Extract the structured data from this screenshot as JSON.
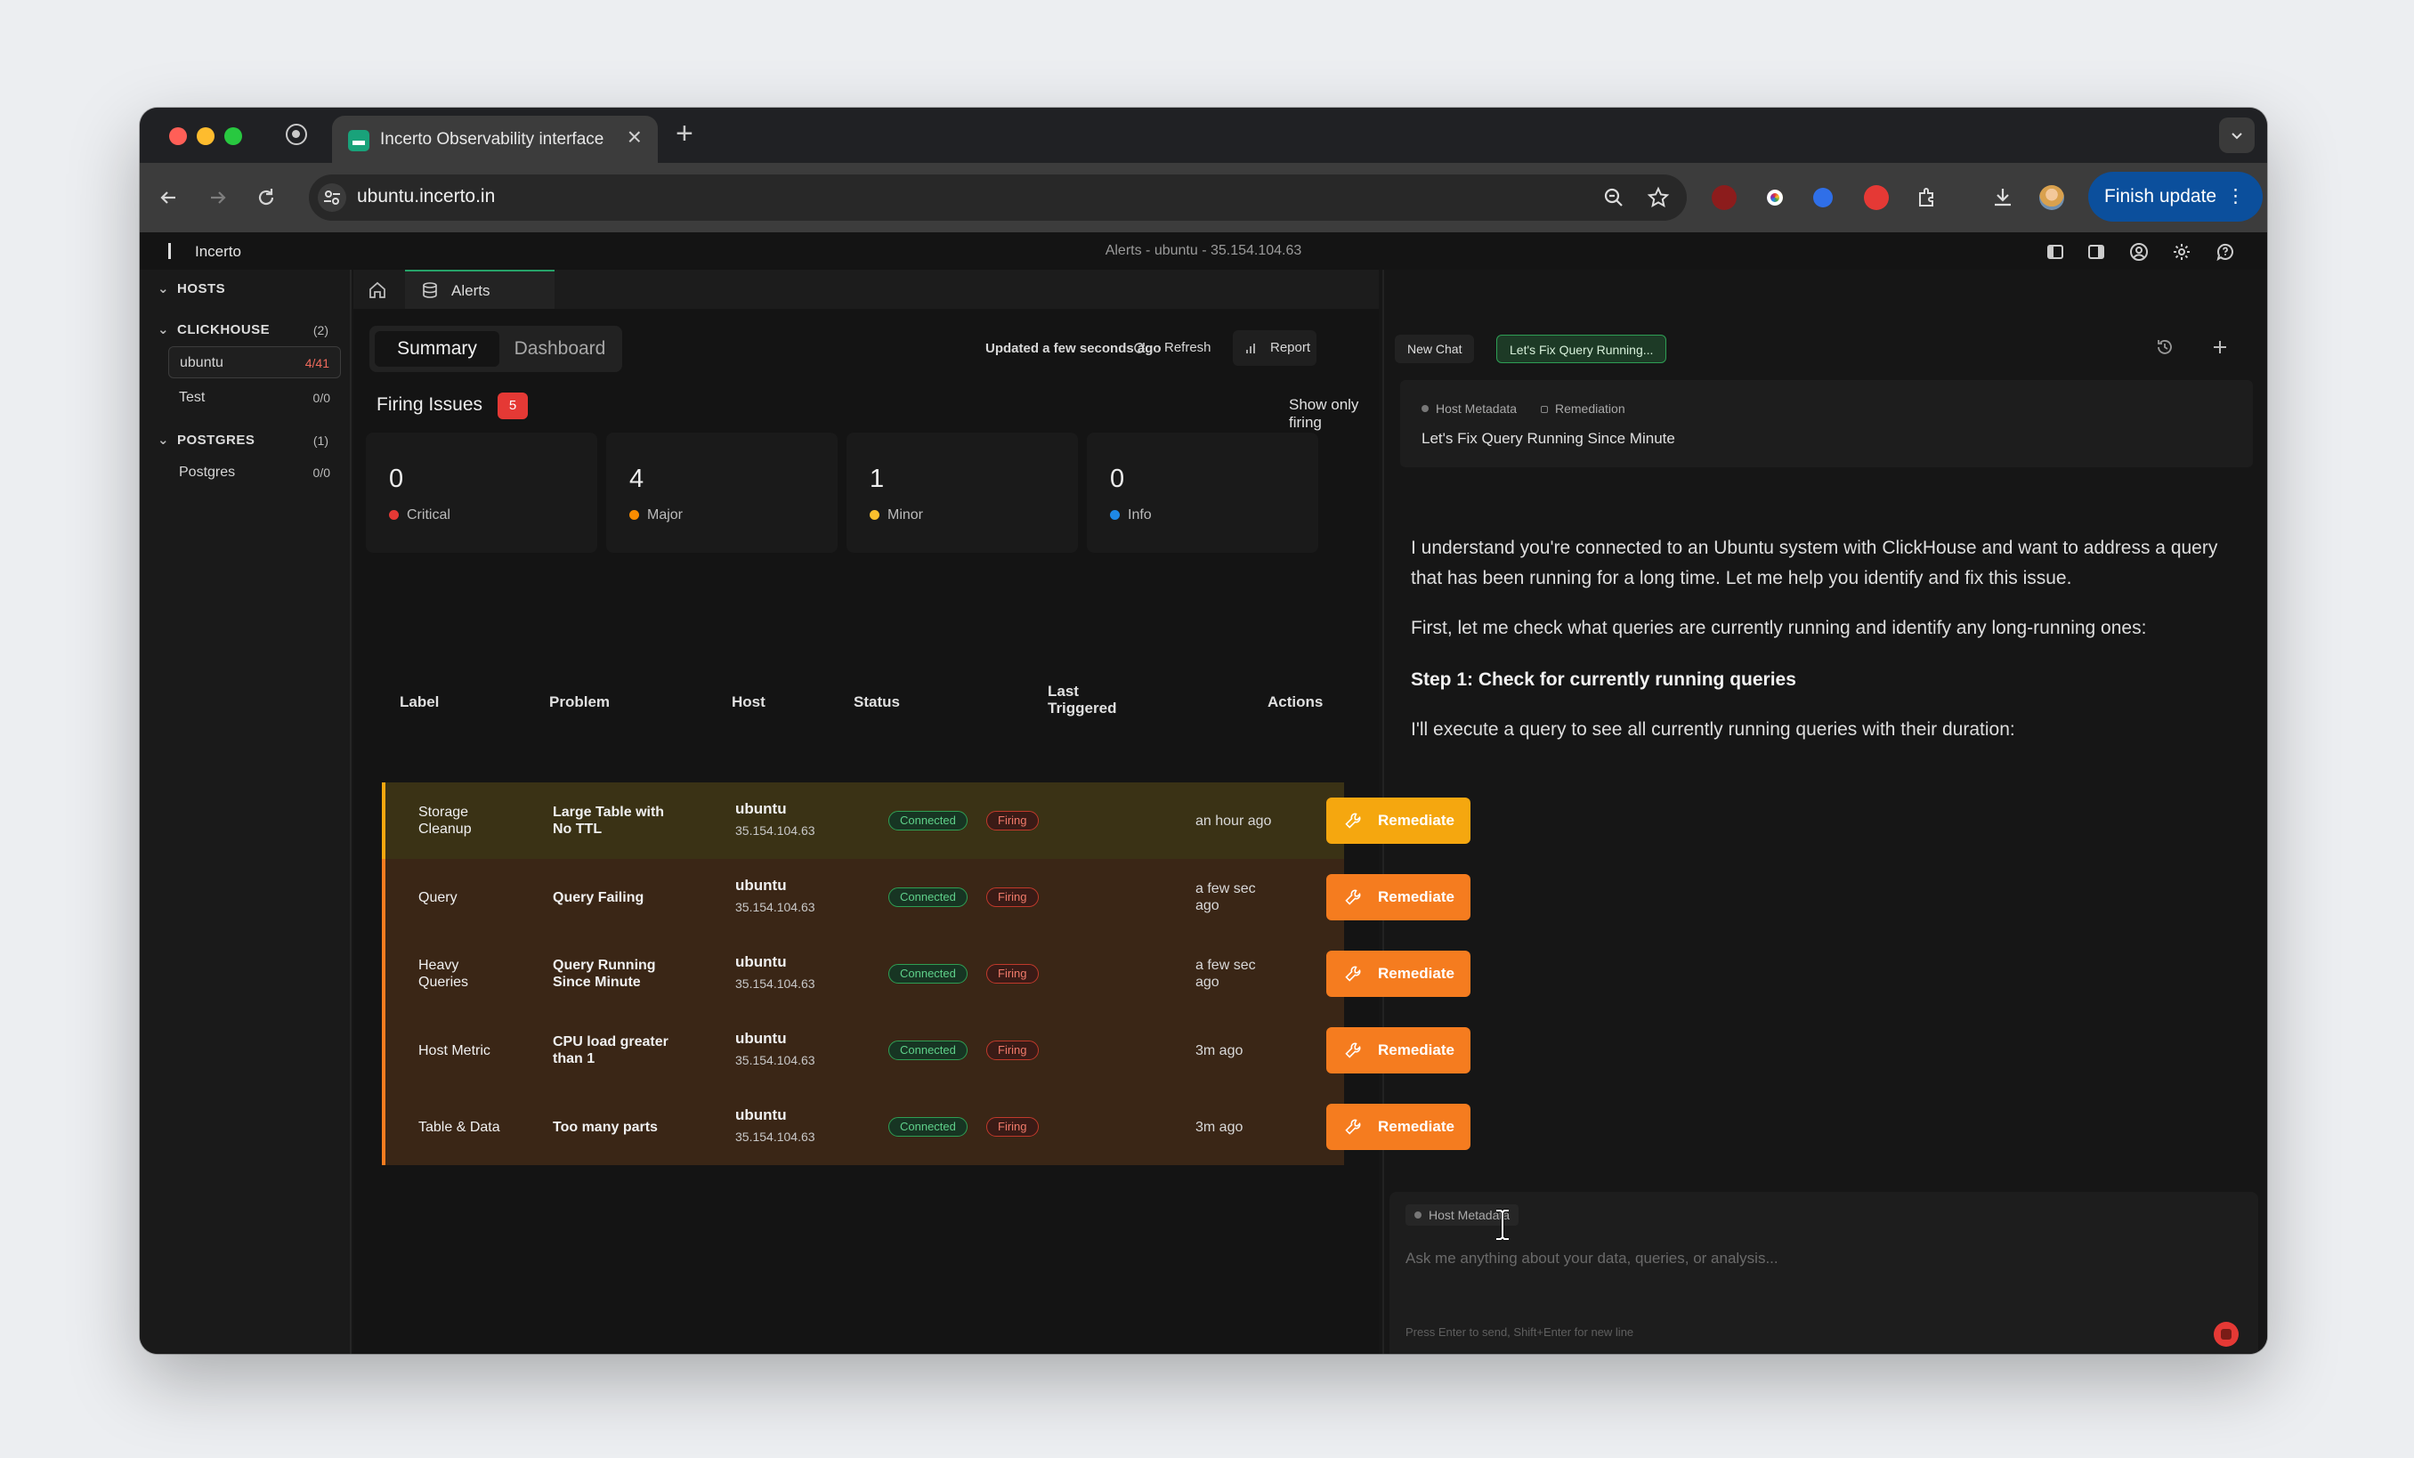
{
  "browser": {
    "tab_title": "Incerto Observability interface",
    "url": "ubuntu.incerto.in",
    "finish_update": "Finish update",
    "close_glyph": "×",
    "newtab_glyph": "+",
    "menu_glyph": "⋮"
  },
  "app": {
    "name": "Incerto",
    "title": "Alerts - ubuntu - 35.154.104.63"
  },
  "sidebar": {
    "hosts_label": "HOSTS",
    "groups": [
      {
        "name": "CLICKHOUSE",
        "count": "(2)",
        "items": [
          {
            "name": "ubuntu",
            "count": "4/41"
          },
          {
            "name": "Test",
            "count": "0/0"
          }
        ]
      },
      {
        "name": "POSTGRES",
        "count": "(1)",
        "items": [
          {
            "name": "Postgres",
            "count": "0/0"
          }
        ]
      }
    ]
  },
  "main": {
    "tab_label": "Alerts",
    "seg": {
      "summary": "Summary",
      "dashboard": "Dashboard"
    },
    "updated": "Updated a few seconds ago",
    "refresh": "Refresh",
    "report": "Report",
    "firing_issues": "Firing Issues",
    "firing_count": "5",
    "show_only_firing": "Show only firing",
    "show_only_firing_on": true,
    "severity": [
      {
        "count": "0",
        "label": "Critical",
        "color": "#e53935"
      },
      {
        "count": "4",
        "label": "Major",
        "color": "#fb8c00"
      },
      {
        "count": "1",
        "label": "Minor",
        "color": "#fbc02d"
      },
      {
        "count": "0",
        "label": "Info",
        "color": "#1e88e5"
      }
    ],
    "columns": {
      "label": "Label",
      "problem": "Problem",
      "host": "Host",
      "status": "Status",
      "last": "Last\nTriggered",
      "actions": "Actions"
    },
    "rows": [
      {
        "label": "Storage\nCleanup",
        "problem": "Large Table with\nNo TTL",
        "host": "ubuntu",
        "ip": "35.154.104.63",
        "conn": "Connected",
        "state": "Firing",
        "last": "an hour ago",
        "action": "Remediate",
        "severity": "minor"
      },
      {
        "label": "Query",
        "problem": "Query Failing",
        "host": "ubuntu",
        "ip": "35.154.104.63",
        "conn": "Connected",
        "state": "Firing",
        "last": "a few sec\nago",
        "action": "Remediate",
        "severity": "major"
      },
      {
        "label": "Heavy\nQueries",
        "problem": "Query Running\nSince Minute",
        "host": "ubuntu",
        "ip": "35.154.104.63",
        "conn": "Connected",
        "state": "Firing",
        "last": "a few sec\nago",
        "action": "Remediate",
        "severity": "major"
      },
      {
        "label": "Host Metric",
        "problem": "CPU load greater\nthan 1",
        "host": "ubuntu",
        "ip": "35.154.104.63",
        "conn": "Connected",
        "state": "Firing",
        "last": "3m ago",
        "action": "Remediate",
        "severity": "major"
      },
      {
        "label": "Table & Data",
        "problem": "Too many parts",
        "host": "ubuntu",
        "ip": "35.154.104.63",
        "conn": "Connected",
        "state": "Firing",
        "last": "3m ago",
        "action": "Remediate",
        "severity": "major"
      }
    ]
  },
  "chat": {
    "new_chat": "New Chat",
    "active_chat": "Let's Fix Query Running...",
    "context": {
      "tag1": "Host Metadata",
      "tag2": "Remediation",
      "title": "Let's Fix Query Running Since Minute"
    },
    "messages": [
      "I understand you're connected to an Ubuntu system with ClickHouse and want to address a query that has been running for a long time. Let me help you identify and fix this issue.",
      "First, let me check what queries are currently running and identify any long-running ones:",
      "Step 1: Check for currently running queries",
      "I'll execute a query to see all currently running queries with their duration:"
    ],
    "input": {
      "tag": "Host Metadata",
      "placeholder": "Ask me anything about your data, queries, or analysis...",
      "value": "",
      "hint": "Press Enter to send, Shift+Enter for new line"
    }
  },
  "colors": {
    "minor_row": "#3a3215",
    "major_row": "#3a2616",
    "minor_btn": "#f5a70f",
    "major_btn": "#f57c1f"
  }
}
